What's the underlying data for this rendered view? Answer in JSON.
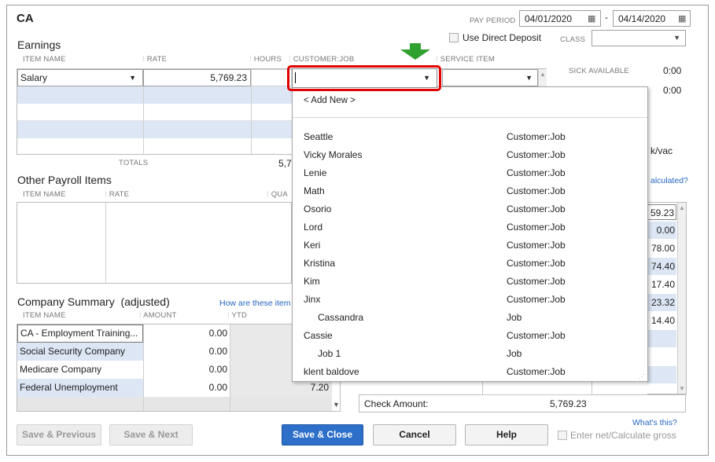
{
  "employee_abbrev": "CA",
  "pay_period": {
    "label": "PAY PERIOD",
    "from": "04/01/2020",
    "dash": "-",
    "to": "04/14/2020"
  },
  "direct_deposit_label": "Use Direct Deposit",
  "class_label": "CLASS",
  "earnings": {
    "title": "Earnings",
    "headers": {
      "item": "ITEM NAME",
      "rate": "RATE",
      "hours": "HOURS",
      "customer": "CUSTOMER:JOB",
      "service": "SERVICE ITEM"
    },
    "row1": {
      "item": "Salary",
      "rate": "5,769.23"
    },
    "totals_label": "TOTALS",
    "totals_value_partial": "5,7"
  },
  "sick": {
    "label": "SICK AVAILABLE",
    "value": "0:00",
    "value2": "0:00",
    "vac_partial": "k/vac"
  },
  "other_payroll": {
    "title": "Other Payroll Items",
    "headers": {
      "item": "ITEM NAME",
      "rate": "RATE",
      "qty_partial": "QUA"
    }
  },
  "right_partial": {
    "calc_link": "alculated?",
    "values": [
      "59.23",
      "0.00",
      "78.00",
      "74.40",
      "17.40",
      "23.32",
      "14.40"
    ]
  },
  "company_summary": {
    "title": "Company Summary  (adjusted)",
    "link": "How are these item",
    "headers": {
      "item": "ITEM NAME",
      "amount": "AMOUNT",
      "ytd": "YTD"
    },
    "rows": [
      {
        "item": "CA - Employment Training...",
        "amount": "0.00",
        "ytd": ""
      },
      {
        "item": "Social Security Company",
        "amount": "0.00",
        "ytd": ""
      },
      {
        "item": "Medicare Company",
        "amount": "0.00",
        "ytd": ""
      },
      {
        "item": "Federal Unemployment",
        "amount": "0.00",
        "ytd": "7.20"
      }
    ]
  },
  "check_amount": {
    "label": "Check Amount:",
    "value": "5,769.23"
  },
  "whats_this": "What's this?",
  "buttons": {
    "save_prev": "Save & Previous",
    "save_next": "Save & Next",
    "save_close": "Save & Close",
    "cancel": "Cancel",
    "help": "Help",
    "net_gross": "Enter net/Calculate gross"
  },
  "dropdown": {
    "add_new": "< Add New >",
    "items": [
      {
        "name": "Seattle",
        "type": "Customer:Job",
        "indent": false
      },
      {
        "name": "Vicky Morales",
        "type": "Customer:Job",
        "indent": false
      },
      {
        "name": "Lenie",
        "type": "Customer:Job",
        "indent": false
      },
      {
        "name": "Math",
        "type": "Customer:Job",
        "indent": false
      },
      {
        "name": "Osorio",
        "type": "Customer:Job",
        "indent": false
      },
      {
        "name": "Lord",
        "type": "Customer:Job",
        "indent": false
      },
      {
        "name": "Keri",
        "type": "Customer:Job",
        "indent": false
      },
      {
        "name": "Kristina",
        "type": "Customer:Job",
        "indent": false
      },
      {
        "name": "Kim",
        "type": "Customer:Job",
        "indent": false
      },
      {
        "name": "Jinx",
        "type": "Customer:Job",
        "indent": false
      },
      {
        "name": "Cassandra",
        "type": "Job",
        "indent": true
      },
      {
        "name": "Cassie",
        "type": "Customer:Job",
        "indent": false
      },
      {
        "name": "Job 1",
        "type": "Job",
        "indent": true
      },
      {
        "name": "klent baldove",
        "type": "Customer:Job",
        "indent": false
      }
    ]
  },
  "colors": {
    "highlight": "#e00000",
    "arrow": "#2fa12f",
    "row_blue": "#dce6f4",
    "primary": "#2e6fc9"
  }
}
